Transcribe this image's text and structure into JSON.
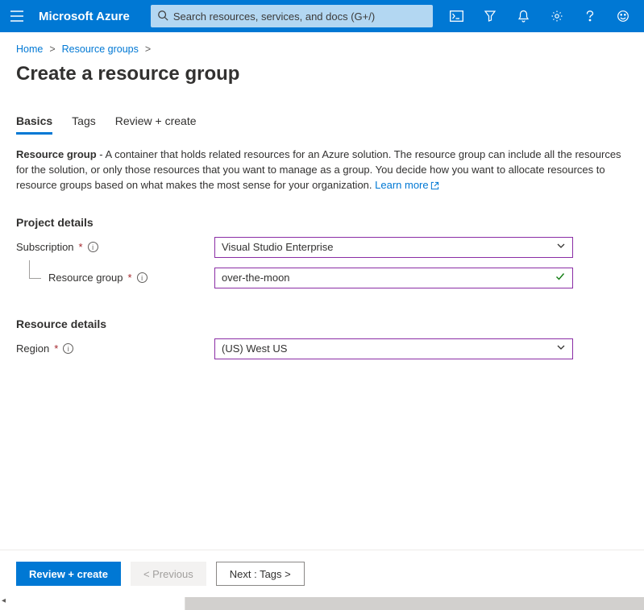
{
  "topbar": {
    "brand": "Microsoft Azure",
    "search_placeholder": "Search resources, services, and docs (G+/)"
  },
  "breadcrumbs": {
    "home": "Home",
    "resource_groups": "Resource groups"
  },
  "page_title": "Create a resource group",
  "tabs": {
    "basics": "Basics",
    "tags": "Tags",
    "review": "Review + create"
  },
  "description": {
    "bold": "Resource group",
    "text": " - A container that holds related resources for an Azure solution. The resource group can include all the resources for the solution, or only those resources that you want to manage as a group. You decide how you want to allocate resources to resource groups based on what makes the most sense for your organization. ",
    "learn_more": "Learn more"
  },
  "sections": {
    "project_details": "Project details",
    "resource_details": "Resource details"
  },
  "fields": {
    "subscription": {
      "label": "Subscription",
      "value": "Visual Studio Enterprise"
    },
    "resource_group": {
      "label": "Resource group",
      "value": "over-the-moon"
    },
    "region": {
      "label": "Region",
      "value": "(US) West US"
    }
  },
  "footer": {
    "review": "Review + create",
    "previous": "< Previous",
    "next": "Next : Tags >"
  }
}
